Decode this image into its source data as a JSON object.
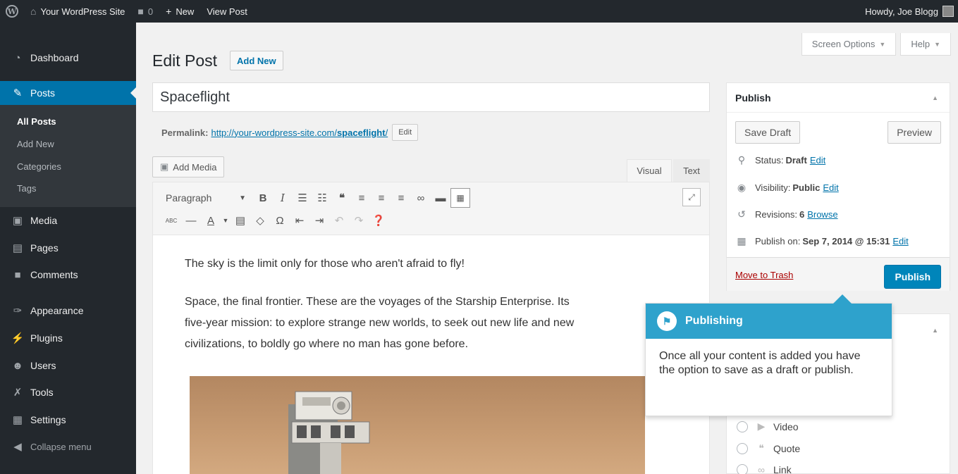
{
  "adminbar": {
    "site_name": "Your WordPress Site",
    "comments_count": "0",
    "new_label": "New",
    "view_post_label": "View Post",
    "howdy": "Howdy, Joe Blogg"
  },
  "menu": {
    "items": [
      {
        "label": "Dashboard",
        "icon": "dashboard-icon"
      },
      {
        "label": "Posts",
        "icon": "pin-icon"
      },
      {
        "label": "Media",
        "icon": "media-icon"
      },
      {
        "label": "Pages",
        "icon": "pages-icon"
      },
      {
        "label": "Comments",
        "icon": "comment-icon"
      },
      {
        "label": "Appearance",
        "icon": "brush-icon"
      },
      {
        "label": "Plugins",
        "icon": "plugin-icon"
      },
      {
        "label": "Users",
        "icon": "users-icon"
      },
      {
        "label": "Tools",
        "icon": "wrench-icon"
      },
      {
        "label": "Settings",
        "icon": "settings-icon"
      },
      {
        "label": "Collapse menu",
        "icon": "collapse-icon"
      }
    ],
    "submenu": [
      "All Posts",
      "Add New",
      "Categories",
      "Tags"
    ]
  },
  "header": {
    "screen_options": "Screen Options",
    "help": "Help",
    "page_title": "Edit Post",
    "add_new": "Add New"
  },
  "post": {
    "title": "Spaceflight",
    "permalink_label": "Permalink:",
    "permalink_base": "http://your-wordpress-site.com/",
    "permalink_slug": "spaceflight",
    "permalink_trail": "/",
    "permalink_edit": "Edit"
  },
  "editor": {
    "add_media": "Add Media",
    "tab_visual": "Visual",
    "tab_text": "Text",
    "format_select": "Paragraph",
    "paragraphs": [
      "The sky is the limit only for those who aren't afraid to fly!",
      "Space, the final frontier. These are the voyages of the Starship Enterprise. Its",
      "five-year mission: to explore strange new worlds, to seek out new life and new",
      "civilizations, to boldly go where no man has gone before."
    ]
  },
  "publish": {
    "title": "Publish",
    "save_draft": "Save Draft",
    "preview": "Preview",
    "status_label": "Status:",
    "status_value": "Draft",
    "visibility_label": "Visibility:",
    "visibility_value": "Public",
    "revisions_label": "Revisions:",
    "revisions_value": "6",
    "browse": "Browse",
    "publish_on_label": "Publish on:",
    "publish_on_value": "Sep 7, 2014 @ 15:31",
    "edit": "Edit",
    "move_to_trash": "Move to Trash",
    "publish_button": "Publish"
  },
  "format": {
    "options": [
      "Video",
      "Quote",
      "Link"
    ]
  },
  "pointer": {
    "title": "Publishing",
    "body": "Once all your content is added you have the option to save as a draft or publish."
  },
  "colors": {
    "admin_dark": "#23282d",
    "accent_blue": "#0073aa",
    "pointer_blue": "#2ea2cc",
    "trash_red": "#a00"
  }
}
